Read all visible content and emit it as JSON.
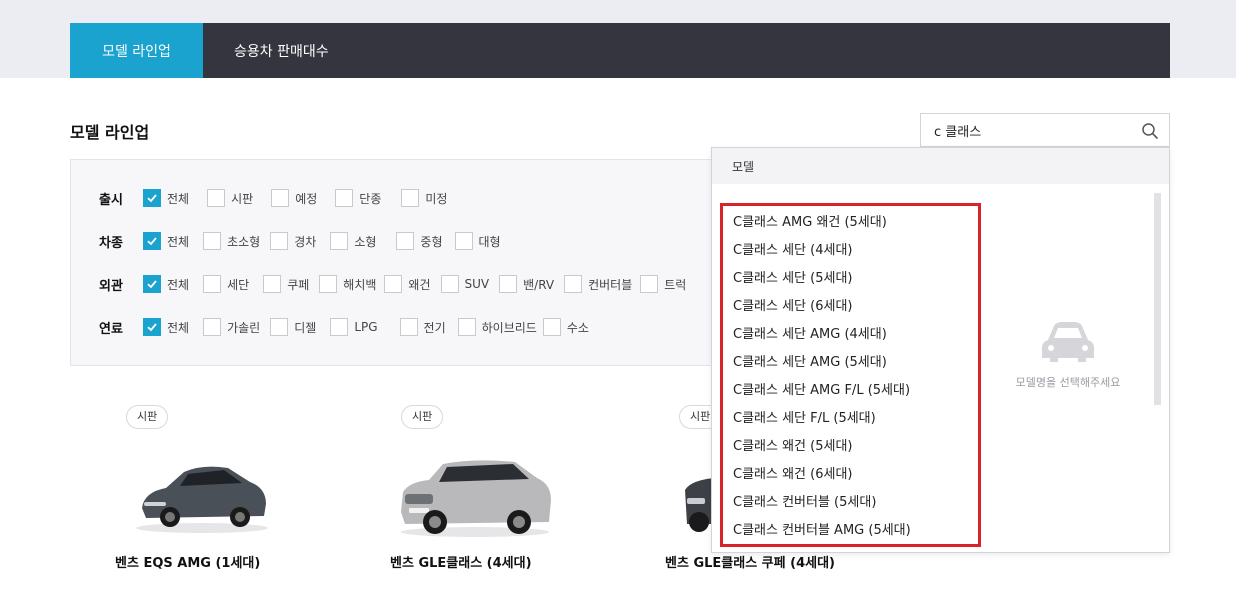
{
  "tabs": [
    {
      "label": "모델 라인업",
      "active": true
    },
    {
      "label": "승용차 판매대수",
      "active": false
    }
  ],
  "page_title": "모델 라인업",
  "search": {
    "value": "c 클래스",
    "placeholder": ""
  },
  "filters": [
    {
      "label": "출시",
      "options": [
        {
          "label": "전체",
          "checked": true
        },
        {
          "label": "시판",
          "checked": false
        },
        {
          "label": "예정",
          "checked": false
        },
        {
          "label": "단종",
          "checked": false
        },
        {
          "label": "미정",
          "checked": false
        }
      ]
    },
    {
      "label": "차종",
      "options": [
        {
          "label": "전체",
          "checked": true
        },
        {
          "label": "초소형",
          "checked": false
        },
        {
          "label": "경차",
          "checked": false
        },
        {
          "label": "소형",
          "checked": false
        },
        {
          "label": "중형",
          "checked": false
        },
        {
          "label": "대형",
          "checked": false
        }
      ]
    },
    {
      "label": "외관",
      "options": [
        {
          "label": "전체",
          "checked": true
        },
        {
          "label": "세단",
          "checked": false
        },
        {
          "label": "쿠페",
          "checked": false
        },
        {
          "label": "해치백",
          "checked": false
        },
        {
          "label": "왜건",
          "checked": false
        },
        {
          "label": "SUV",
          "checked": false
        },
        {
          "label": "밴/RV",
          "checked": false
        },
        {
          "label": "컨버터블",
          "checked": false
        },
        {
          "label": "트럭",
          "checked": false
        }
      ]
    },
    {
      "label": "연료",
      "options": [
        {
          "label": "전체",
          "checked": true
        },
        {
          "label": "가솔린",
          "checked": false
        },
        {
          "label": "디젤",
          "checked": false
        },
        {
          "label": "LPG",
          "checked": false
        },
        {
          "label": "전기",
          "checked": false
        },
        {
          "label": "하이브리드",
          "checked": false
        },
        {
          "label": "수소",
          "checked": false
        }
      ]
    }
  ],
  "dropdown": {
    "header": "모델",
    "items": [
      "C클래스 AMG 왜건 (5세대)",
      "C클래스 세단 (4세대)",
      "C클래스 세단 (5세대)",
      "C클래스 세단 (6세대)",
      "C클래스 세단 AMG (4세대)",
      "C클래스 세단 AMG (5세대)",
      "C클래스 세단 AMG F/L (5세대)",
      "C클래스 세단 F/L (5세대)",
      "C클래스 왜건 (5세대)",
      "C클래스 왜건 (6세대)",
      "C클래스 컨버터블 (5세대)",
      "C클래스 컨버터블 AMG (5세대)"
    ],
    "empty_text": "모델명을 선택해주세요"
  },
  "cars": [
    {
      "badge": "시판",
      "name": "벤츠 EQS AMG (1세대)",
      "color": "#4a5058"
    },
    {
      "badge": "시판",
      "name": "벤츠 GLE클래스 (4세대)",
      "color": "#b9b9bc"
    },
    {
      "badge": "시판",
      "name": "벤츠 GLE클래스 쿠페 (4세대)",
      "color": "#3d4046"
    }
  ],
  "colors": {
    "accent": "#1ba3cf",
    "tabbar": "#353540",
    "highlight": "#d9232b"
  }
}
